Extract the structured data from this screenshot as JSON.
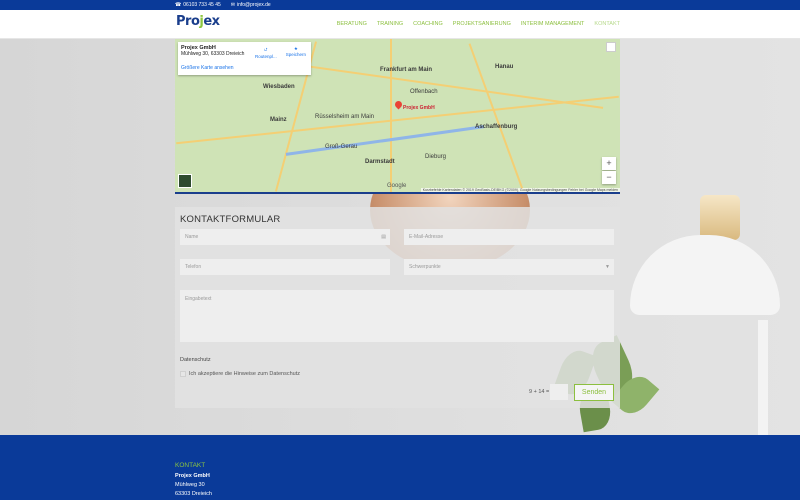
{
  "topbar": {
    "phone": "06103 733 45 45",
    "email": "info@projex.de"
  },
  "logo": {
    "text_a": "Pro",
    "text_o": "j",
    "text_b": "ex"
  },
  "nav": {
    "items": [
      "Beratung",
      "Training",
      "Coaching",
      "Projektsanierung",
      "Interim Management",
      "Kontakt"
    ],
    "active": "Kontakt"
  },
  "map": {
    "card_title": "Projex GmbH",
    "card_address": "Mühlweg 30, 63303 Dreieich",
    "card_link": "Größere Karte ansehen",
    "action_route": "Routenpl...",
    "action_save": "Speichern",
    "pin_label": "Projex GmbH",
    "cities": [
      "Frankfurt am Main",
      "Wiesbaden",
      "Mainz",
      "Offenbach",
      "Hanau",
      "Darmstadt",
      "Aschaffenburg",
      "Rüsselsheim am Main",
      "Groß-Gerau",
      "Dieburg"
    ],
    "zoom_in": "+",
    "zoom_out": "−",
    "google": "Google",
    "footer": "Kurzbefehle  Kartendaten © 2019 GeoBasis-DE/BKG (©2009), Google  Nutzungsbedingungen  Fehler bei Google Maps melden"
  },
  "form": {
    "title": "KONTAKTFORMULAR",
    "name_placeholder": "Name",
    "email_placeholder": "E-Mail-Adresse",
    "phone_placeholder": "Telefon",
    "focus_placeholder": "Schwerpunkte",
    "message_placeholder": "Eingabetext",
    "privacy_label": "Datenschutz",
    "privacy_checkbox": "Ich akzeptiere die Hinweise zum Datenschutz",
    "captcha": "9 + 14 =",
    "send": "Senden"
  },
  "footer": {
    "title": "KONTAKT",
    "company": "Projex GmbH",
    "street": "Mühlweg 30",
    "city": "63303 Dreieich"
  },
  "colors": {
    "brand_blue": "#0a3a99",
    "accent_green": "#8cbf3f"
  }
}
